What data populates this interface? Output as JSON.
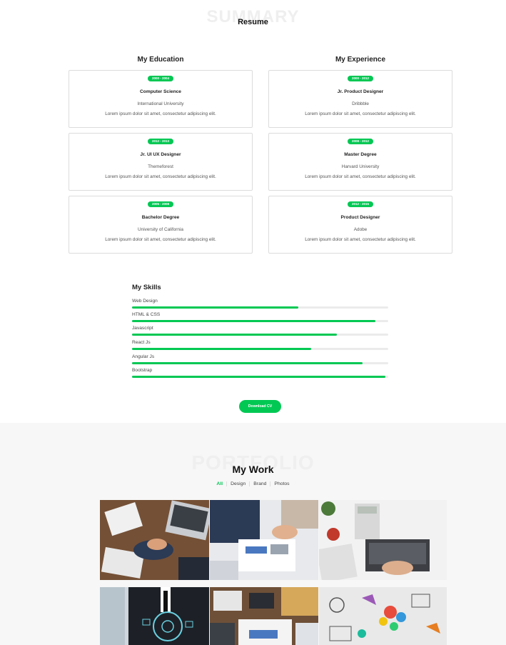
{
  "resume": {
    "bg_title": "SUMMARY",
    "title": "Resume",
    "education_heading": "My Education",
    "experience_heading": "My Experience",
    "education": [
      {
        "years": "2000 - 2004",
        "title": "Computer Science",
        "place": "International University",
        "desc": "Lorem ipsum dolor sit amet, consectetur adipiscing elit."
      },
      {
        "years": "2012 - 2013",
        "title": "Jr. UI UX Designer",
        "place": "Themeforest",
        "desc": "Lorem ipsum dolor sit amet, consectetur adipiscing elit."
      },
      {
        "years": "2005 - 2008",
        "title": "Bachelor Degree",
        "place": "University of California",
        "desc": "Lorem ipsum dolor sit amet, consectetur adipiscing elit."
      }
    ],
    "experience": [
      {
        "years": "2000 - 2012",
        "title": "Jr. Product Designer",
        "place": "Dribbble",
        "desc": "Lorem ipsum dolor sit amet, consectetur adipiscing elit."
      },
      {
        "years": "2008 - 2012",
        "title": "Master Degree",
        "place": "Harvard University",
        "desc": "Lorem ipsum dolor sit amet, consectetur adipiscing elit."
      },
      {
        "years": "2012 - 2015",
        "title": "Product Designer",
        "place": "Adobe",
        "desc": "Lorem ipsum dolor sit amet, consectetur adipiscing elit."
      }
    ],
    "skills_heading": "My Skills",
    "skills": [
      {
        "name": "Web Design",
        "level": 0.65
      },
      {
        "name": "HTML & CSS",
        "level": 0.95
      },
      {
        "name": "Javascript",
        "level": 0.8
      },
      {
        "name": "React Js",
        "level": 0.7
      },
      {
        "name": "Angular Js",
        "level": 0.9
      },
      {
        "name": "Bootstrap",
        "level": 0.99
      }
    ],
    "download_label": "Download CV"
  },
  "portfolio": {
    "bg_title": "PORTFOLIO",
    "title": "My Work",
    "filters": [
      "All",
      "Design",
      "Brand",
      "Photos"
    ],
    "active_filter": "All"
  },
  "colors": {
    "accent": "#00c853"
  }
}
